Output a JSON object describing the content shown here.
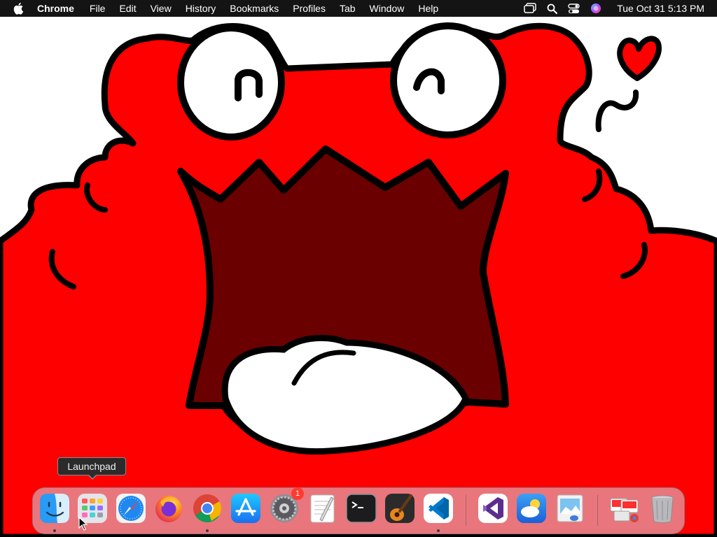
{
  "menubar": {
    "apple_icon": "apple-logo-icon",
    "app_name": "Chrome",
    "menus": [
      "File",
      "Edit",
      "View",
      "History",
      "Bookmarks",
      "Profiles",
      "Tab",
      "Window",
      "Help"
    ],
    "status_icons": [
      "window-switcher-icon",
      "search-icon",
      "control-center-icon",
      "siri-icon"
    ],
    "clock": "Tue Oct 31  5:13 PM"
  },
  "tooltip": {
    "text": "Launchpad"
  },
  "dock": {
    "apps": [
      {
        "name": "Finder",
        "icon": "finder-icon",
        "running": true
      },
      {
        "name": "Launchpad",
        "icon": "launchpad-icon",
        "running": false
      },
      {
        "name": "Safari",
        "icon": "safari-icon",
        "running": false
      },
      {
        "name": "Firefox",
        "icon": "firefox-icon",
        "running": false
      },
      {
        "name": "Google Chrome",
        "icon": "chrome-icon",
        "running": true
      },
      {
        "name": "App Store",
        "icon": "app-store-icon",
        "running": false
      },
      {
        "name": "System Settings",
        "icon": "system-settings-icon",
        "running": false,
        "badge": "1"
      },
      {
        "name": "TextEdit",
        "icon": "textedit-icon",
        "running": false
      },
      {
        "name": "Terminal",
        "icon": "terminal-icon",
        "running": false
      },
      {
        "name": "GarageBand",
        "icon": "garageband-icon",
        "running": false
      },
      {
        "name": "Visual Studio Code",
        "icon": "vscode-icon",
        "running": true
      }
    ],
    "recent": [
      {
        "name": "Visual Studio",
        "icon": "visual-studio-icon"
      },
      {
        "name": "Weather",
        "icon": "weather-icon"
      },
      {
        "name": "Preview",
        "icon": "preview-icon"
      }
    ],
    "stack": {
      "name": "Downloads",
      "icon": "downloads-stack-icon"
    },
    "trash": {
      "name": "Trash",
      "icon": "trash-icon"
    }
  },
  "colors": {
    "wallpaper_red": "#ff0000",
    "mouth_dark": "#6b0000",
    "menubar_bg": "#141414",
    "badge_red": "#ff3b30"
  }
}
